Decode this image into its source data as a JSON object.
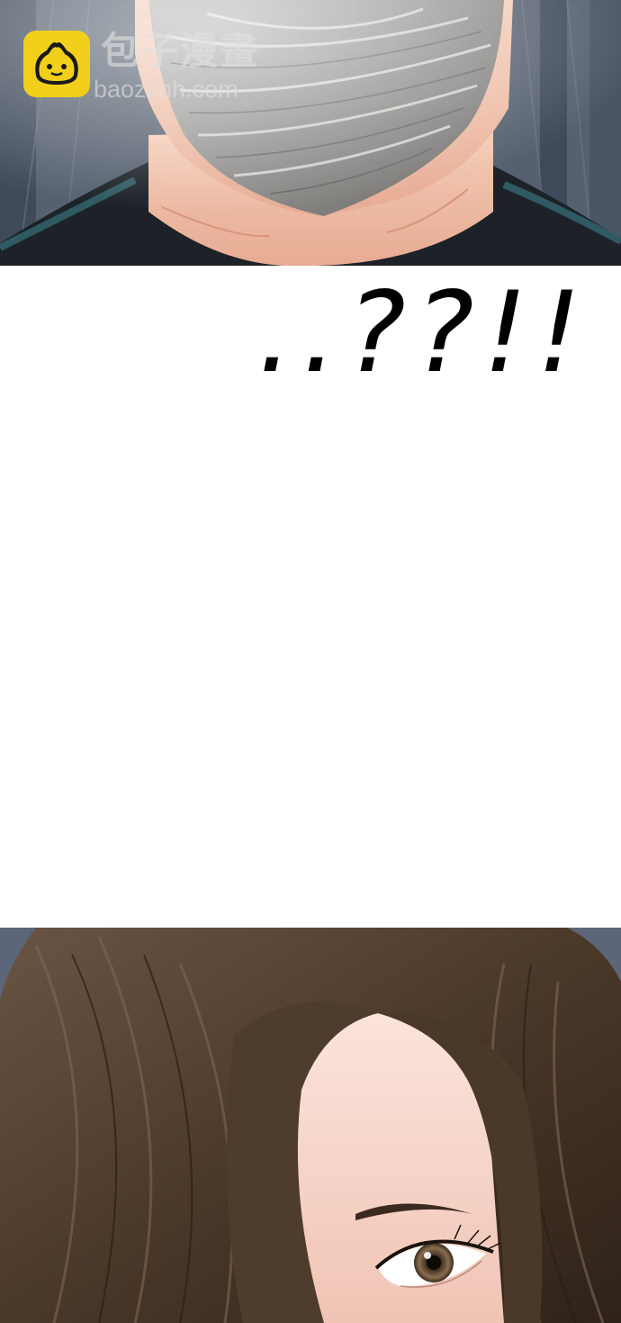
{
  "watermark": {
    "brand_cn": "包子漫畫",
    "url": "baozimh.com",
    "logo_color": "#f2cf1b"
  },
  "panels": {
    "top": {
      "icon": "masked-face-illustration"
    },
    "middle": {
      "sfx_text": "..??!!"
    },
    "bottom": {
      "icon": "woman-eye-illustration"
    }
  },
  "colors": {
    "mask": "#9a9a98",
    "skin": "#efc2ab",
    "hair": "#4d3b2c",
    "background_top": "#55606e"
  }
}
